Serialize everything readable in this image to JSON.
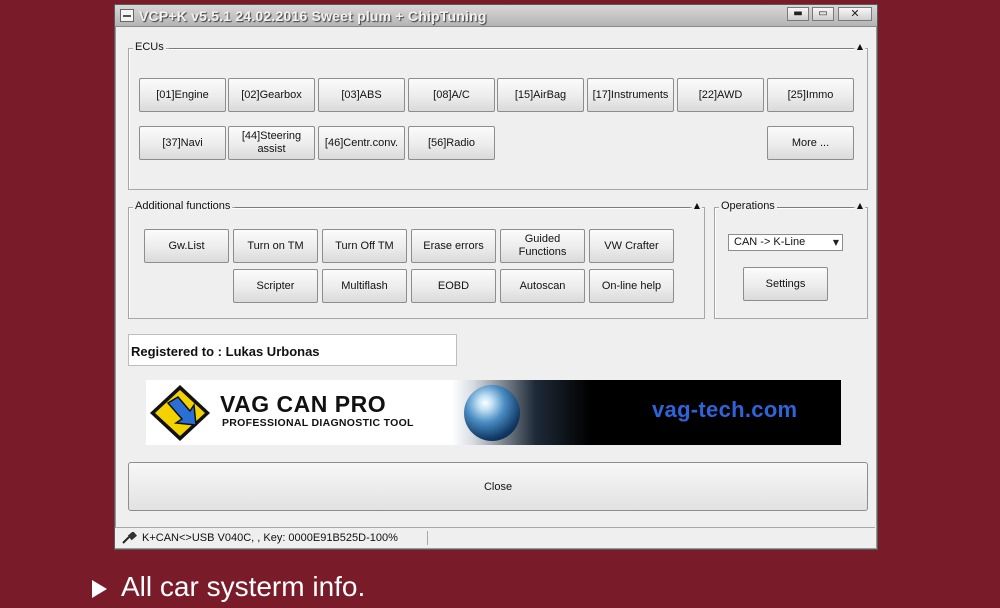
{
  "window": {
    "title": "VCP+K v5.5.1 24.02.2016 Sweet plum + ChipTuning",
    "min_glyph": "▬",
    "max_glyph": "▭",
    "close_glyph": "✕"
  },
  "ecus": {
    "label": "ECUs",
    "collapse_glyph": "▲",
    "buttons": [
      "[01]Engine",
      "[02]Gearbox",
      "[03]ABS",
      "[08]A/C",
      "[15]AirBag",
      "[17]Instruments",
      "[22]AWD",
      "[25]Immo",
      "[37]Navi",
      "[44]Steering assist",
      "[46]Centr.conv.",
      "[56]Radio"
    ],
    "more_label": "More ..."
  },
  "additional": {
    "label": "Additional functions",
    "collapse_glyph": "▲",
    "buttons": [
      "Gw.List",
      "Turn on TM",
      "Turn Off TM",
      "Erase errors",
      "Guided Functions",
      "VW Crafter",
      "Scripter",
      "Multiflash",
      "EOBD",
      "Autoscan",
      "On-line help"
    ]
  },
  "operations": {
    "label": "Operations",
    "collapse_glyph": "▲",
    "protocol_selected": "CAN -> K-Line",
    "dropdown_glyph": "▼",
    "settings_label": "Settings"
  },
  "registration": {
    "text": "Registered to : Lukas Urbonas"
  },
  "banner": {
    "brand": "VAG CAN PRO",
    "tagline": "PROFESSIONAL DIAGNOSTIC TOOL",
    "url": "vag-tech.com",
    "logo_color": "#f2d300"
  },
  "close_label": "Close",
  "status": {
    "text": "K+CAN<>USB V040C, , Key: 0000E91B525D-100%"
  },
  "caption": {
    "text": "All car systerm info."
  },
  "colors": {
    "background": "#7a1b2a",
    "window": "#efefef",
    "url_blue": "#2f63d8"
  }
}
